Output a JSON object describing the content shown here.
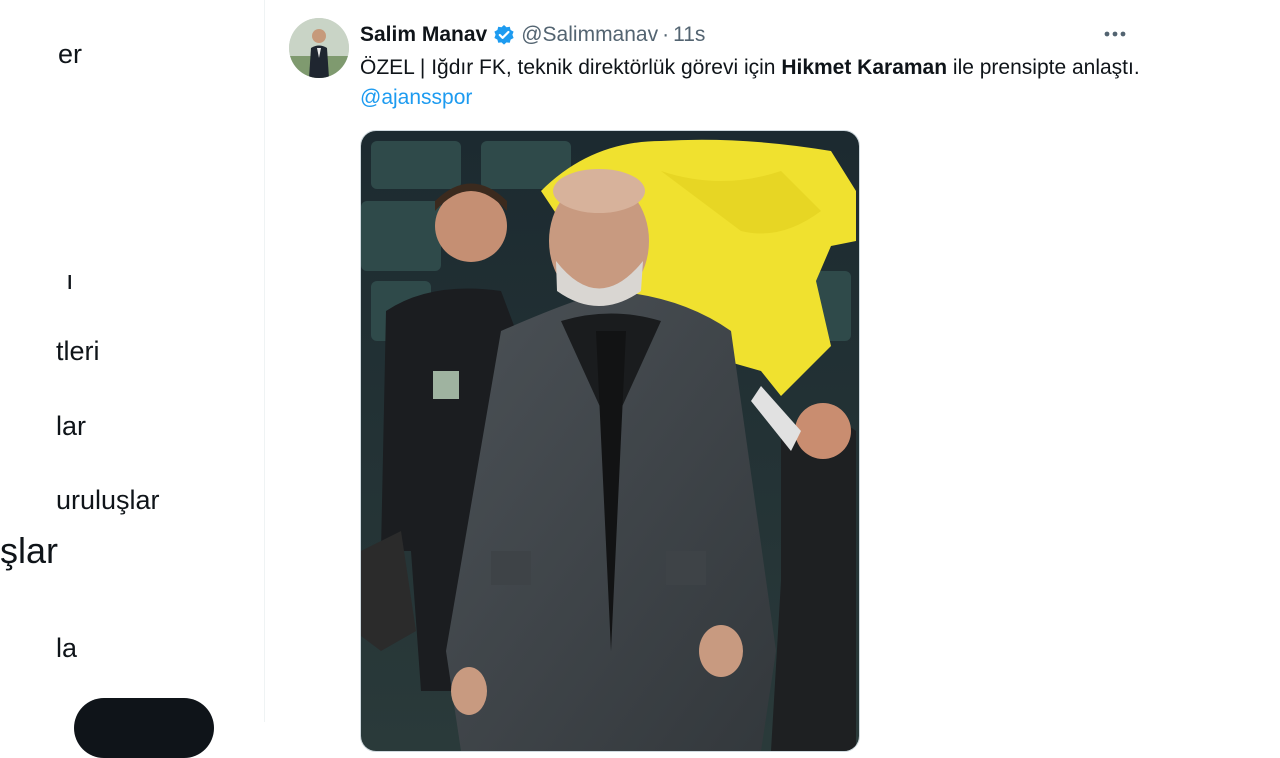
{
  "sidebar": {
    "items": [
      {
        "label": "er"
      },
      {
        "label": "ı"
      },
      {
        "label": "tleri"
      },
      {
        "label": "lar"
      },
      {
        "label": "uruluşlar"
      },
      {
        "label": "şlar"
      },
      {
        "label": "la"
      }
    ]
  },
  "tweet": {
    "author_name": "Salim Manav",
    "handle": "@Salimmanav",
    "separator": "·",
    "time": "11s",
    "text_part1": "ÖZEL | Iğdır FK, teknik direktörlük görevi için ",
    "text_bold": "Hikmet Karaman",
    "text_part2": " ile prensipte anlaştı. ",
    "mention": "@ajansspor",
    "more_icon": "more-horizontal-icon",
    "verified_icon": "verified-badge-icon",
    "colors": {
      "accent": "#1d9bf0",
      "secondary_text": "#536471",
      "text": "#0f1419"
    }
  }
}
